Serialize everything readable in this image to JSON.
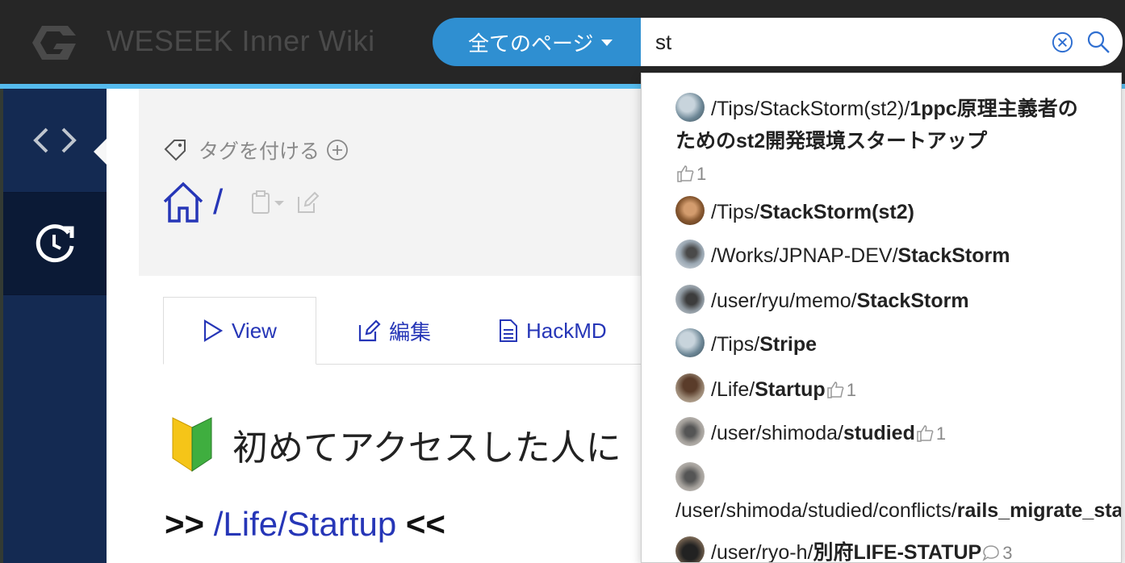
{
  "navbar": {
    "brand": "WESEEK Inner Wiki",
    "search_scope": "全てのページ",
    "search_value": "st"
  },
  "page": {
    "tag_label": "タグを付ける",
    "breadcrumb_slash": "/",
    "tabs": [
      {
        "label": "View"
      },
      {
        "label": "編集"
      },
      {
        "label": "HackMD"
      }
    ],
    "heading": "初めてアクセスした人に",
    "startup_prefix": ">> ",
    "startup_link": "/Life/Startup",
    "startup_suffix": " <<"
  },
  "results": [
    {
      "prefix": "/Tips/StackStorm(st2)/",
      "bold": "1ppc原理主義者のためのst2開発環境スタートアップ",
      "meta": "1",
      "meta_type": "like"
    },
    {
      "prefix": "/Tips/",
      "bold": "StackStorm(st2)",
      "meta": "",
      "meta_type": ""
    },
    {
      "prefix": "/Works/JPNAP-DEV/",
      "bold": "StackStorm",
      "meta": "",
      "meta_type": ""
    },
    {
      "prefix": "/user/ryu/memo/",
      "bold": "StackStorm",
      "meta": "",
      "meta_type": ""
    },
    {
      "prefix": "/Tips/",
      "bold": "Stripe",
      "meta": "",
      "meta_type": ""
    },
    {
      "prefix": "/Life/",
      "bold": "Startup",
      "meta": "1",
      "meta_type": "like"
    },
    {
      "prefix": "/user/shimoda/",
      "bold": "studied",
      "meta": "1",
      "meta_type": "like"
    },
    {
      "prefix": "/user/shimoda/studied/conflicts/",
      "bold": "rails_migrate_status",
      "meta": "",
      "meta_type": ""
    },
    {
      "prefix": "/user/ryo-h/",
      "bold": "別府LIFE-STATUP",
      "meta": "3",
      "meta_type": "comment"
    }
  ],
  "colors": {
    "navbar_bg": "#262626",
    "accent": "#55bbee",
    "scope_blue": "#2f8fd1",
    "sidebar": "#142a52",
    "link": "#2636b7"
  }
}
